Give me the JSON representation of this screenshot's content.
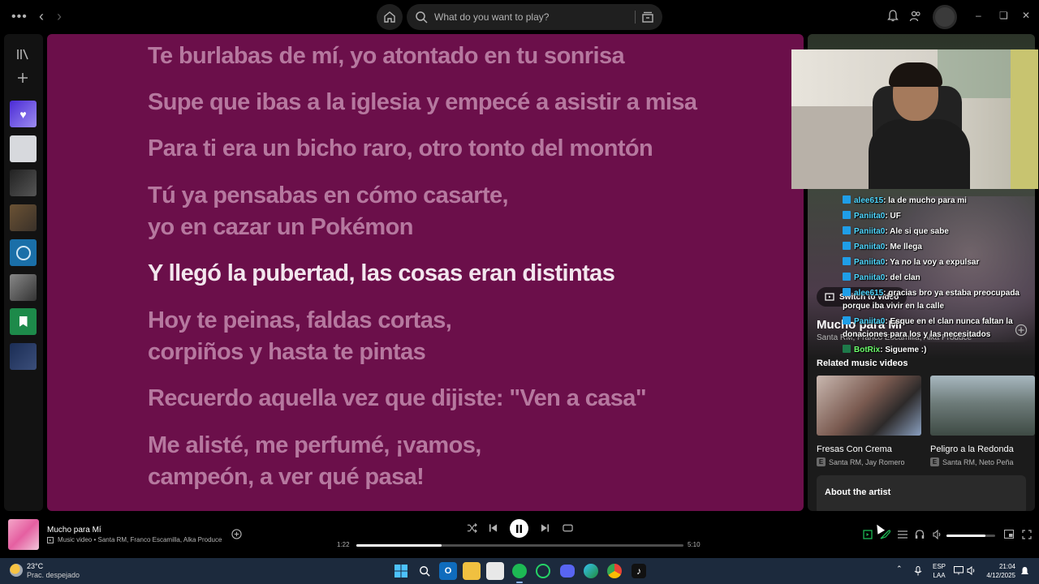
{
  "topbar": {
    "search_placeholder": "What do you want to play?"
  },
  "lyrics": [
    {
      "text": "Te burlabas de mí, yo atontado en tu sonrisa",
      "active": false
    },
    {
      "text": "Supe que ibas a la iglesia y empecé a asistir a misa",
      "active": false
    },
    {
      "text": "Para ti era un bicho raro, otro tonto del montón",
      "active": false
    },
    {
      "text": "Tú ya pensabas en cómo casarte,",
      "active": false
    },
    {
      "text": "yo en cazar un Pokémon",
      "active": false
    },
    {
      "text": "Y llegó la pubertad, las cosas eran distintas",
      "active": true
    },
    {
      "text": "Hoy te peinas, faldas cortas,",
      "active": false
    },
    {
      "text": "corpiños y hasta te pintas",
      "active": false
    },
    {
      "text": "Recuerdo aquella vez que dijiste: \"Ven a casa\"",
      "active": false
    },
    {
      "text": "Me alisté, me perfumé, ¡vamos,",
      "active": false
    },
    {
      "text": "campeón, a ver qué pasa!",
      "active": false
    }
  ],
  "right_panel": {
    "switch_to_video": "Switch to video",
    "title": "Mucho para Mí",
    "subtitle": "Santa RM, Franco Escamilla, Alka Produce",
    "related_heading": "Related music videos",
    "related": [
      {
        "title": "Fresas Con Crema",
        "artists": "Santa RM, Jay Romero",
        "explicit": "E"
      },
      {
        "title": "Peligro a la Redonda",
        "artists": "Santa RM, Neto Peña",
        "explicit": "E"
      }
    ],
    "about_artist": "About the artist"
  },
  "chat": [
    {
      "user": "alee615",
      "text": ": la de mucho para mi",
      "color": "cyan"
    },
    {
      "user": "Paniita0",
      "text": ": UF",
      "color": "cyan"
    },
    {
      "user": "Paniita0",
      "text": ": Ale si que sabe",
      "color": "cyan"
    },
    {
      "user": "Paniita0",
      "text": ": Me llega",
      "color": "cyan"
    },
    {
      "user": "Paniita0",
      "text": ": Ya no la voy a expulsar",
      "color": "cyan"
    },
    {
      "user": "Paniita0",
      "text": ": del clan",
      "color": "cyan"
    },
    {
      "user": "alee615",
      "text": ": gracias bro ya estaba preocupada porque iba vivir en la calle",
      "color": "cyan"
    },
    {
      "user": "Paniita0",
      "text": ": Esque en el clan nunca faltan la donaciones para los y las necesitados",
      "color": "cyan"
    },
    {
      "user": "BotRix",
      "text": ": Sigueme :)",
      "color": "green"
    }
  ],
  "player": {
    "track_title": "Mucho para Mí",
    "track_sub": "Music video • Santa RM, Franco Escamilla, Alka Produce",
    "elapsed": "1:22",
    "duration": "5:10",
    "progress": 0.26,
    "volume": 0.8
  },
  "taskbar": {
    "temperature": "23°C",
    "condition": "Prac. despejado",
    "lang_top": "ESP",
    "lang_bottom": "LAA",
    "time": "21:04",
    "date": "4/12/2025"
  },
  "colors": {
    "lyrics_bg": "#6b0f4a",
    "lyric_inactive": "#b6789f",
    "lyric_active": "#f3e6ee",
    "spotify_green": "#1db954"
  }
}
